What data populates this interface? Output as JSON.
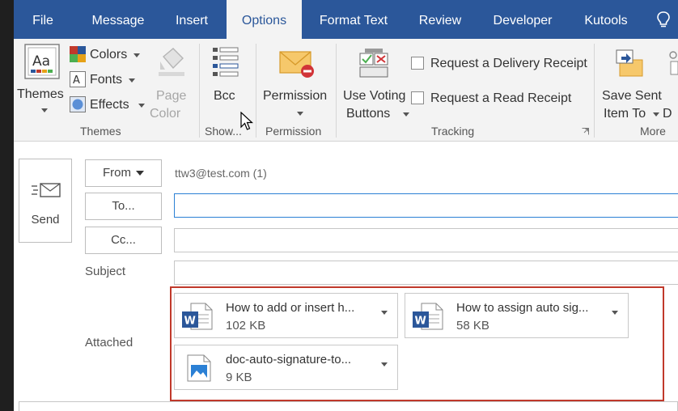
{
  "colors": {
    "accent": "#2b579a",
    "highlight": "#c0392b",
    "word_blue": "#2b579a"
  },
  "tabs": [
    {
      "label": "File",
      "active": false
    },
    {
      "label": "Message",
      "active": false
    },
    {
      "label": "Insert",
      "active": false
    },
    {
      "label": "Options",
      "active": true
    },
    {
      "label": "Format Text",
      "active": false
    },
    {
      "label": "Review",
      "active": false
    },
    {
      "label": "Developer",
      "active": false
    },
    {
      "label": "Kutools",
      "active": false
    }
  ],
  "ribbon": {
    "themes": {
      "themes_label": "Themes",
      "colors_label": "Colors",
      "fonts_label": "Fonts",
      "effects_label": "Effects",
      "page_color_line1": "Page",
      "page_color_line2": "Color",
      "group_label": "Themes"
    },
    "show": {
      "bcc_label": "Bcc",
      "group_label": "Show..."
    },
    "permission": {
      "permission_label": "Permission",
      "group_label": "Permission"
    },
    "tracking": {
      "voting_line1": "Use Voting",
      "voting_line2": "Buttons",
      "delivery_receipt": "Request a Delivery Receipt",
      "read_receipt": "Request a Read Receipt",
      "group_label": "Tracking"
    },
    "more": {
      "save_sent_line1": "Save Sent",
      "save_sent_line2": "Item To",
      "save_sent_extra": "D",
      "group_label": "More"
    }
  },
  "compose": {
    "send_label": "Send",
    "from_label": "From",
    "from_value": "ttw3@test.com (1)",
    "to_label": "To...",
    "to_value": "",
    "cc_label": "Cc...",
    "cc_value": "",
    "subject_label": "Subject",
    "subject_value": "",
    "attached_label": "Attached",
    "attachments": [
      {
        "name": "How to add or insert h...",
        "size": "102 KB",
        "icon": "word-doc-icon"
      },
      {
        "name": "How to assign auto sig...",
        "size": "58 KB",
        "icon": "word-doc-icon"
      },
      {
        "name": "doc-auto-signature-to...",
        "size": "9 KB",
        "icon": "image-file-icon"
      }
    ]
  }
}
